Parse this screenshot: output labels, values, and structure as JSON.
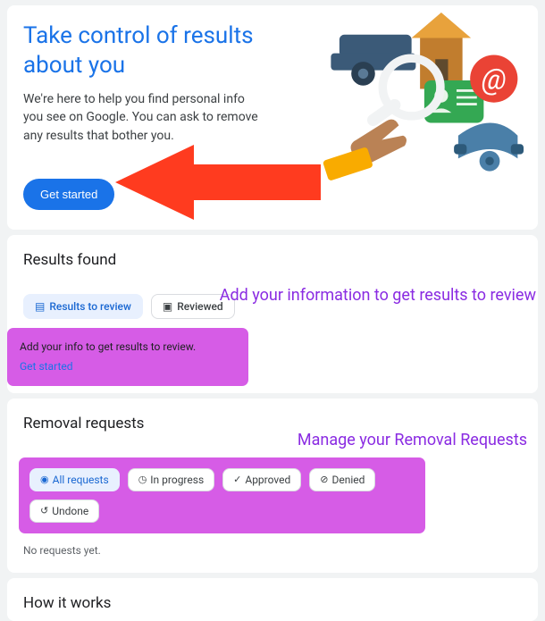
{
  "hero": {
    "title": "Take control of results about you",
    "description": "We're here to help you find personal info you see on Google. You can ask to remove any results that bother you.",
    "button_label": "Get started"
  },
  "results": {
    "title": "Results found",
    "tabs": {
      "to_review": "Results to review",
      "reviewed": "Reviewed"
    },
    "annotation": "Add your information to get results to review",
    "prompt_text": "Add your info to get results to review.",
    "prompt_link": "Get started"
  },
  "removal": {
    "title": "Removal requests",
    "annotation": "Manage your Removal Requests",
    "filters": {
      "all": "All requests",
      "in_progress": "In progress",
      "approved": "Approved",
      "denied": "Denied",
      "undone": "Undone"
    },
    "empty": "No requests yet."
  },
  "how": {
    "title": "How it works"
  }
}
